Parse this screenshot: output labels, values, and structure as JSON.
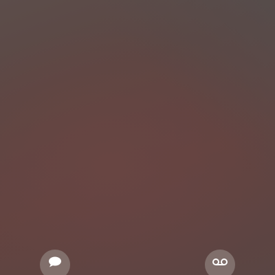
{
  "screen": {
    "background_colors": [
      "#5c4d4a",
      "#634340",
      "#684542"
    ]
  },
  "actions": {
    "message": {
      "icon": "speech-bubble-icon"
    },
    "voicemail": {
      "icon": "voicemail-icon"
    }
  }
}
